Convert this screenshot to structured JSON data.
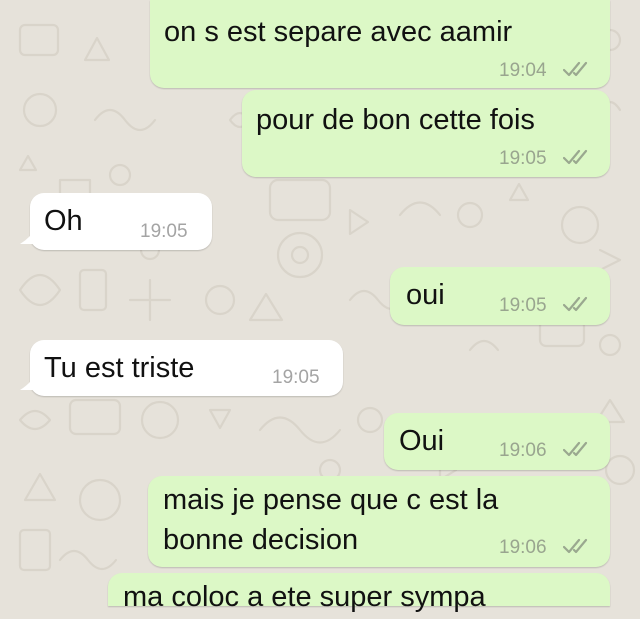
{
  "colors": {
    "outgoing_bubble": "#dcf8c6",
    "incoming_bubble": "#ffffff",
    "wallpaper": "#e6e2da",
    "read_ticks": "#9aa88f"
  },
  "messages": [
    {
      "direction": "out",
      "text_lines": [
        "on s est separe avec aamir"
      ],
      "time": "19:04",
      "status": "read-ticks-icon"
    },
    {
      "direction": "out",
      "text_lines": [
        "pour de bon cette fois"
      ],
      "time": "19:05",
      "status": "read-ticks-icon"
    },
    {
      "direction": "in",
      "text_lines": [
        "Oh"
      ],
      "time": "19:05"
    },
    {
      "direction": "out",
      "text_lines": [
        "oui"
      ],
      "time": "19:05",
      "status": "read-ticks-icon"
    },
    {
      "direction": "in",
      "text_lines": [
        "Tu est triste"
      ],
      "time": "19:05"
    },
    {
      "direction": "out",
      "text_lines": [
        "Oui"
      ],
      "time": "19:06",
      "status": "read-ticks-icon"
    },
    {
      "direction": "out",
      "text_lines": [
        "mais je pense que c est la",
        "bonne decision"
      ],
      "time": "19:06",
      "status": "read-ticks-icon"
    },
    {
      "direction": "out",
      "text_lines": [
        "ma coloc a ete super sympa"
      ],
      "time": "",
      "status": ""
    }
  ]
}
